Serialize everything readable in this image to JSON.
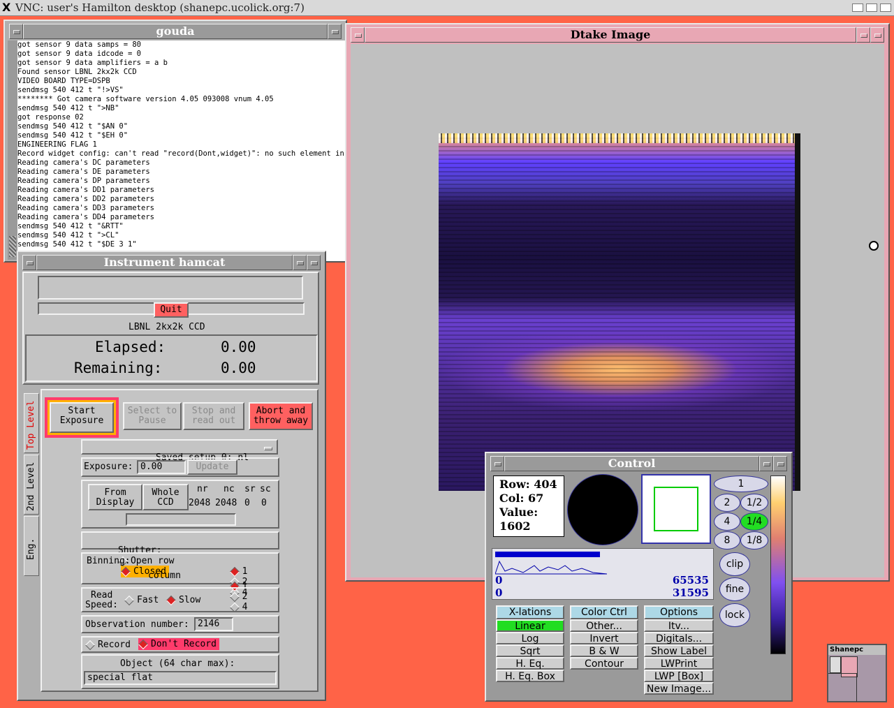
{
  "vnc": {
    "title": "VNC: user's Hamilton desktop (shanepc.ucolick.org:7)",
    "corner_label": "xterm"
  },
  "gouda": {
    "title": "gouda",
    "lines": [
      "got sensor 9 data samps = 80",
      "got sensor 9 data idcode = 0",
      "got sensor 9 data amplifiers = a b",
      "Found sensor LBNL 2kx2k CCD",
      "VIDEO BOARD TYPE=DSPB",
      "sendmsg 540 412 t \"!>VS\"",
      "******** Got camera software version 4.05 093008 vnum 4.05",
      "sendmsg 540 412 t \">NB\"",
      "got response 02",
      "sendmsg 540 412 t \"$AN 0\"",
      "sendmsg 540 412 t \"$EH 0\"",
      "ENGINEERING FLAG 1",
      "Record widget config: can't read \"record(Dont,widget)\": no such element in arr",
      "Reading camera's DC parameters",
      "Reading camera's DE parameters",
      "Reading camera's DP parameters",
      "Reading camera's DD1 parameters",
      "Reading camera's DD2 parameters",
      "Reading camera's DD3 parameters",
      "Reading camera's DD4 parameters",
      "sendmsg 540 412 t \"&RTT\"",
      "sendmsg 540 412 t \">CL\"",
      "sendmsg 540 412 t \"$DE 3 1\""
    ]
  },
  "instrument": {
    "title": "Instrument hamcat",
    "quit": "Quit",
    "ccd": "LBNL 2kx2k CCD",
    "elapsed_label": "Elapsed:",
    "elapsed": "0.00",
    "remaining_label": "Remaining:",
    "remaining": "0.00",
    "tabs": [
      "Top Level",
      "2nd Level",
      "Eng."
    ],
    "buttons": {
      "start": [
        "Start",
        "Exposure"
      ],
      "pause": [
        "Select to",
        "Pause"
      ],
      "stop": [
        "Stop and",
        "read out"
      ],
      "abort": [
        "Abort and",
        "throw away"
      ]
    },
    "saved_setup": "Saved setup 0: nl",
    "exposure_label": "Exposure:",
    "exposure_value": "0.00",
    "update": "Update",
    "from_display": [
      "From",
      "Display"
    ],
    "whole_ccd": [
      "Whole",
      "CCD"
    ],
    "roi_headers": [
      "nr",
      "nc",
      "sr",
      "sc"
    ],
    "roi_values": [
      "2048",
      "2048",
      "0",
      "0"
    ],
    "shutter_label": "Shutter:",
    "shutter_open": "Open",
    "shutter_closed": "Closed",
    "binning_label": "Binning:",
    "row_label": "row",
    "column_label": "column",
    "bin_options": [
      "1",
      "2",
      "4"
    ],
    "read_speed_label": [
      "Read",
      "Speed:"
    ],
    "fast": "Fast",
    "slow": "Slow",
    "obs_label": "Observation number:",
    "obs_value": "2146",
    "record": "Record",
    "dont_record": "Don't Record",
    "object_label": "Object (64 char max):",
    "object_value": "special flat"
  },
  "dtake": {
    "title": "Dtake Image"
  },
  "control": {
    "title": "Control",
    "row": "Row: 404",
    "col": "Col: 67",
    "value_label": "Value:",
    "value": "1602",
    "zoom": [
      "1",
      "2",
      "1/2",
      "4",
      "1/4",
      "8",
      "1/8"
    ],
    "zoom_selected": "1/4",
    "clip": "clip",
    "fine": "fine",
    "lock": "lock",
    "hist_min_1": "0",
    "hist_max_1": "65535",
    "hist_min_2": "0",
    "hist_max_2": "31595",
    "menus": {
      "xlations": {
        "header": "X-lations",
        "items": [
          "Linear",
          "Log",
          "Sqrt",
          "H. Eq.",
          "H. Eq. Box"
        ],
        "selected": "Linear"
      },
      "color": {
        "header": "Color Ctrl",
        "items": [
          "Other...",
          "Invert",
          "B & W",
          "Contour"
        ]
      },
      "options": {
        "header": "Options",
        "items": [
          "Itv...",
          "Digitals...",
          "Show Label",
          "LWPrint",
          "LWP [Box]",
          "New Image..."
        ]
      }
    }
  },
  "pager": {
    "title": "Shanepc Pager"
  },
  "colors": {
    "desktop": "#ff6347",
    "accent_red": "#ff6060",
    "selected_green": "#22dd22",
    "cyan_header": "#add8e6",
    "frame_pink": "#e8a7b4"
  }
}
